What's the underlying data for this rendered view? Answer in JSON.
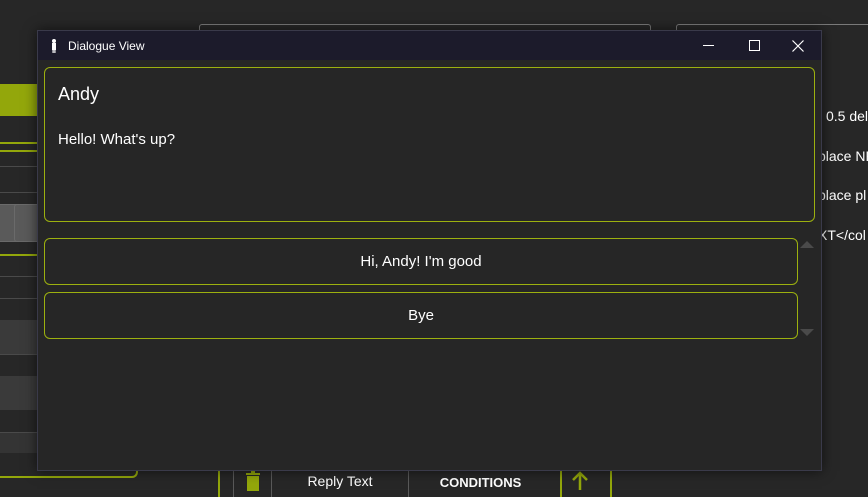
{
  "window": {
    "title": "Dialogue View",
    "minimize_icon": "minimize-icon",
    "maximize_icon": "maximize-icon",
    "close_icon": "close-icon"
  },
  "speaker": {
    "name": "Andy",
    "text": "Hello! What's up?"
  },
  "replies": [
    {
      "label": "Hi, Andy! I'm good"
    },
    {
      "label": "Bye"
    }
  ],
  "background": {
    "right_texts": [
      "0.5 del",
      "place NP",
      "place pl",
      "XT</col"
    ],
    "bottom_bar": {
      "reply_text_label": "Reply Text",
      "conditions_label": "CONDITIONS"
    }
  },
  "colors": {
    "accent": "#9cb00f",
    "titlebar": "#1c1b2b",
    "panel": "#262626"
  }
}
